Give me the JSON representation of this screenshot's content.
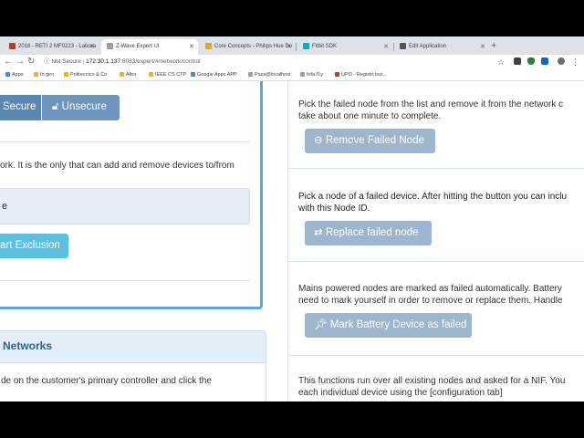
{
  "browser": {
    "tabs": [
      {
        "label": "2018 - RETI 2 MF0223 - Labora",
        "favicon_color": "#c0392b",
        "active": false
      },
      {
        "label": "Z-Wave Expert UI",
        "favicon_color": "#9e9e9e",
        "active": true
      },
      {
        "label": "Core Concepts - Philips Hue De",
        "favicon_color": "#f4a300",
        "active": false
      },
      {
        "label": "Fitbit SDK",
        "favicon_color": "#00b0b9",
        "active": false
      },
      {
        "label": "Edit Application",
        "favicon_color": "#555555",
        "active": false
      }
    ],
    "new_tab_label": "+",
    "url_security": "Not Secure",
    "url_host": "172.30.1.137",
    "url_rest": ":8083/expert/#/network/control",
    "bookmarks": [
      {
        "label": "Apps",
        "color": "#4285f4"
      },
      {
        "label": "In giro",
        "color": "#f4b400"
      },
      {
        "label": "Politecnico & Co",
        "color": "#f4b400"
      },
      {
        "label": "Altro",
        "color": "#f4b400"
      },
      {
        "label": "IEEE CS CTP",
        "color": "#f4b400"
      },
      {
        "label": "Google Apps APP",
        "color": "#4285f4"
      },
      {
        "label": "Pass@localhost",
        "color": "#9e9e9e"
      },
      {
        "label": "fofa.f1y",
        "color": "#9e9e9e"
      },
      {
        "label": "UPO - Registri lezi...",
        "color": "#c0392b"
      }
    ]
  },
  "left": {
    "secure_label": "Secure",
    "unsecure_label": "Unsecure",
    "controller_text": "ork. It is the only that can add and remove devices to/from",
    "field_text": "e",
    "start_exclusion_label": "art Exclusion",
    "networks_title": "Networks",
    "networks_text": "de on the customer's primary controller and click the"
  },
  "right": {
    "remove_failed_text_1": "Pick the failed node from the list and remove it from the network c",
    "remove_failed_text_2": "take about one minute to complete.",
    "remove_failed_label": "Remove Failed Node",
    "replace_text_1": "Pick a node of a failed device. After hitting the button you can inclu",
    "replace_text_2": "with this Node ID.",
    "replace_label": "Replace failed node",
    "battery_text_1": "Mains powered nodes are marked as failed automatically. Battery",
    "battery_text_2": "need to mark yourself in order to remove or replace them. Handle",
    "battery_label": "Mark Battery Device as failed",
    "nif_text_1": "This functions run over all existing nodes and asked for a NIF. You",
    "nif_text_2": "each individual device using the [configuration tab]"
  },
  "colors": {
    "primary_blue": "#5b87b3",
    "info_blue": "#5bc0de",
    "disabled_blue": "#9db5cd",
    "panel_border": "#5aa9dd"
  }
}
